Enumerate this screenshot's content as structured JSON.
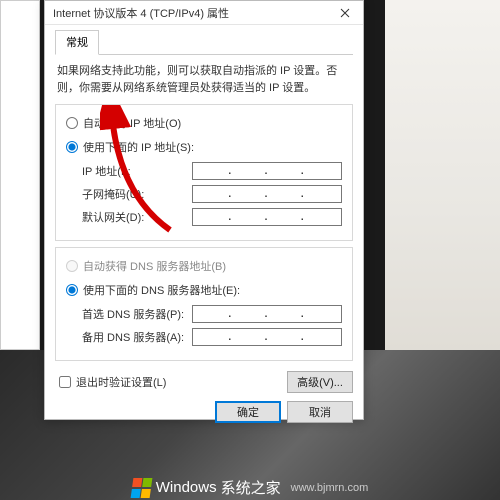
{
  "dialog": {
    "title": "Internet 协议版本 4 (TCP/IPv4) 属性",
    "tab": "常规",
    "description": "如果网络支持此功能，则可以获取自动指派的 IP 设置。否则，你需要从网络系统管理员处获得适当的 IP 设置。"
  },
  "ip_section": {
    "auto_label": "自动获得 IP 地址(O)",
    "manual_label": "使用下面的 IP 地址(S):",
    "selected": "manual",
    "fields": {
      "ip_label": "IP 地址(I):",
      "mask_label": "子网掩码(U):",
      "gateway_label": "默认网关(D):"
    }
  },
  "dns_section": {
    "auto_label": "自动获得 DNS 服务器地址(B)",
    "manual_label": "使用下面的 DNS 服务器地址(E):",
    "selected": "manual",
    "auto_disabled": true,
    "fields": {
      "primary_label": "首选 DNS 服务器(P):",
      "alt_label": "备用 DNS 服务器(A):"
    }
  },
  "validate_checkbox": "退出时验证设置(L)",
  "buttons": {
    "advanced": "高级(V)...",
    "ok": "确定",
    "cancel": "取消"
  },
  "watermark": {
    "brand": "Windows",
    "site": "系统之家",
    "url": "www.bjmrn.com"
  }
}
